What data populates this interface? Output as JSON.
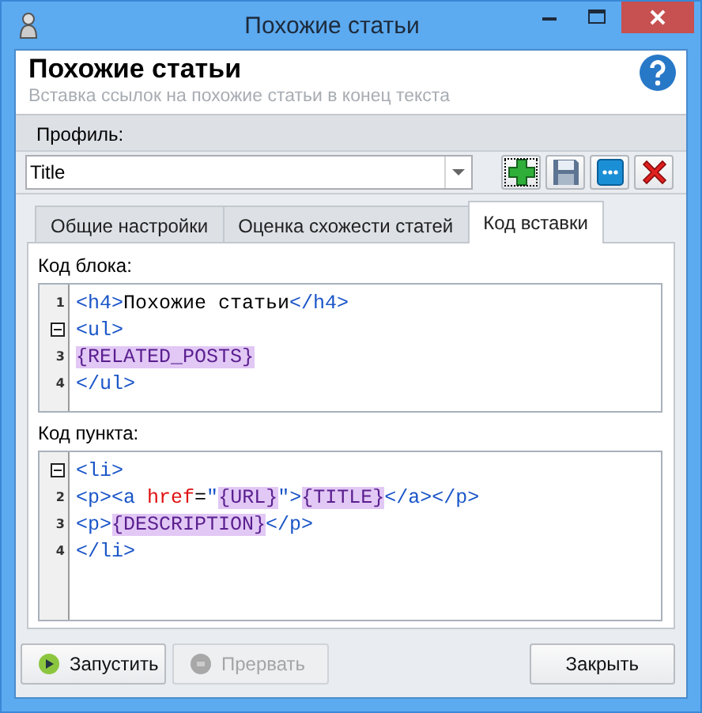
{
  "window": {
    "title": "Похожие статьи"
  },
  "header": {
    "title": "Похожие статьи",
    "subtitle": "Вставка ссылок на похожие статьи в конец текста"
  },
  "profile": {
    "label": "Профиль:",
    "value": "Title"
  },
  "toolbar": [
    {
      "kind": "add",
      "focused": true
    },
    {
      "kind": "save",
      "focused": false
    },
    {
      "kind": "more",
      "focused": false
    },
    {
      "kind": "delete",
      "focused": false
    }
  ],
  "tabs": [
    {
      "label": "Общие настройки",
      "selected": false
    },
    {
      "label": "Оценка схожести статей",
      "selected": false
    },
    {
      "label": "Код вставки",
      "selected": true
    }
  ],
  "editors": [
    {
      "label": "Код блока:",
      "lines": [
        {
          "kind": "number",
          "number": "1",
          "tokens": [
            {
              "kind": "tag",
              "text": "<h4>"
            },
            {
              "kind": "text",
              "text": "Похожие статьи"
            },
            {
              "kind": "tag",
              "text": "</h4>"
            }
          ]
        },
        {
          "kind": "fold",
          "tokens": [
            {
              "kind": "tag",
              "text": "<ul>"
            }
          ]
        },
        {
          "kind": "number",
          "number": "3",
          "tokens": [
            {
              "kind": "var",
              "text": "{RELATED_POSTS}"
            }
          ]
        },
        {
          "kind": "number",
          "number": "4",
          "tokens": [
            {
              "kind": "tag",
              "text": "</ul>"
            }
          ]
        }
      ]
    },
    {
      "label": "Код пункта:",
      "lines": [
        {
          "kind": "fold",
          "tokens": [
            {
              "kind": "tag",
              "text": "<li>"
            }
          ]
        },
        {
          "kind": "number",
          "number": "2",
          "tokens": [
            {
              "kind": "tag",
              "text": "<p><a "
            },
            {
              "kind": "attr",
              "text": "href"
            },
            {
              "kind": "text",
              "text": "="
            },
            {
              "kind": "tag",
              "text": "\""
            },
            {
              "kind": "var",
              "text": "{URL}"
            },
            {
              "kind": "tag",
              "text": "\">"
            },
            {
              "kind": "var",
              "text": "{TITLE}"
            },
            {
              "kind": "tag",
              "text": "</a></p>"
            }
          ]
        },
        {
          "kind": "number",
          "number": "3",
          "tokens": [
            {
              "kind": "tag",
              "text": "<p>"
            },
            {
              "kind": "var",
              "text": "{DESCRIPTION}"
            },
            {
              "kind": "tag",
              "text": "</p>"
            }
          ]
        },
        {
          "kind": "number",
          "number": "4",
          "tokens": [
            {
              "kind": "tag",
              "text": "</li>"
            }
          ]
        }
      ]
    }
  ],
  "buttons": [
    {
      "kind": "run",
      "label": "Запустить",
      "disabled": false
    },
    {
      "kind": "stop",
      "label": "Прервать",
      "disabled": true
    },
    {
      "kind": "close",
      "label": "Закрыть",
      "disabled": false
    }
  ]
}
